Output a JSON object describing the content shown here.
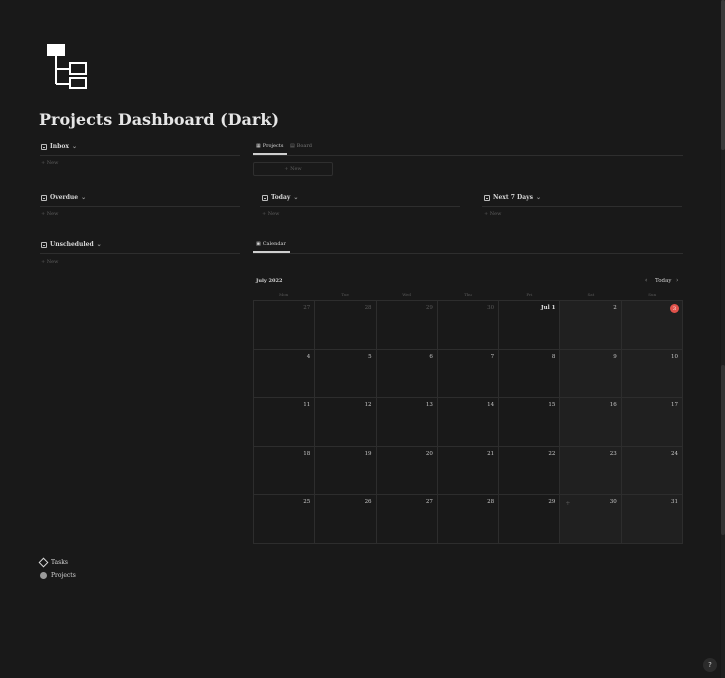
{
  "page": {
    "title": "Projects Dashboard (Dark)",
    "icon": "tree-hierarchy-icon"
  },
  "sections": {
    "inbox": {
      "label": "Inbox",
      "new": "+ New"
    },
    "overdue": {
      "label": "Overdue",
      "new": "+ New"
    },
    "unscheduled": {
      "label": "Unscheduled",
      "new": "+ New"
    },
    "today": {
      "label": "Today",
      "new": "+ New"
    },
    "next7": {
      "label": "Next 7 Days",
      "new": "+ New"
    }
  },
  "projects_view": {
    "tabs": [
      {
        "label": "Projects",
        "icon": "table-icon"
      },
      {
        "label": "Board",
        "icon": "board-icon"
      }
    ],
    "new": "+ New"
  },
  "calendar_view": {
    "tab": {
      "label": "Calendar",
      "icon": "calendar-icon"
    },
    "month_label": "July 2022",
    "today_label": "Today",
    "weekdays": [
      "Mon",
      "Tue",
      "Wed",
      "Thu",
      "Fri",
      "Sat",
      "Sun"
    ],
    "days": [
      "27",
      "28",
      "29",
      "30",
      "Jul 1",
      "2",
      "3",
      "4",
      "5",
      "6",
      "7",
      "8",
      "9",
      "10",
      "11",
      "12",
      "13",
      "14",
      "15",
      "16",
      "17",
      "18",
      "19",
      "20",
      "21",
      "22",
      "23",
      "24",
      "25",
      "26",
      "27",
      "28",
      "29",
      "30",
      "31"
    ],
    "today_index": 6,
    "accent_color": "#e0524b"
  },
  "footer": {
    "links": [
      {
        "label": "Tasks",
        "icon": "diamond-icon"
      },
      {
        "label": "Projects",
        "icon": "globe-icon"
      }
    ]
  },
  "help": {
    "label": "?"
  }
}
